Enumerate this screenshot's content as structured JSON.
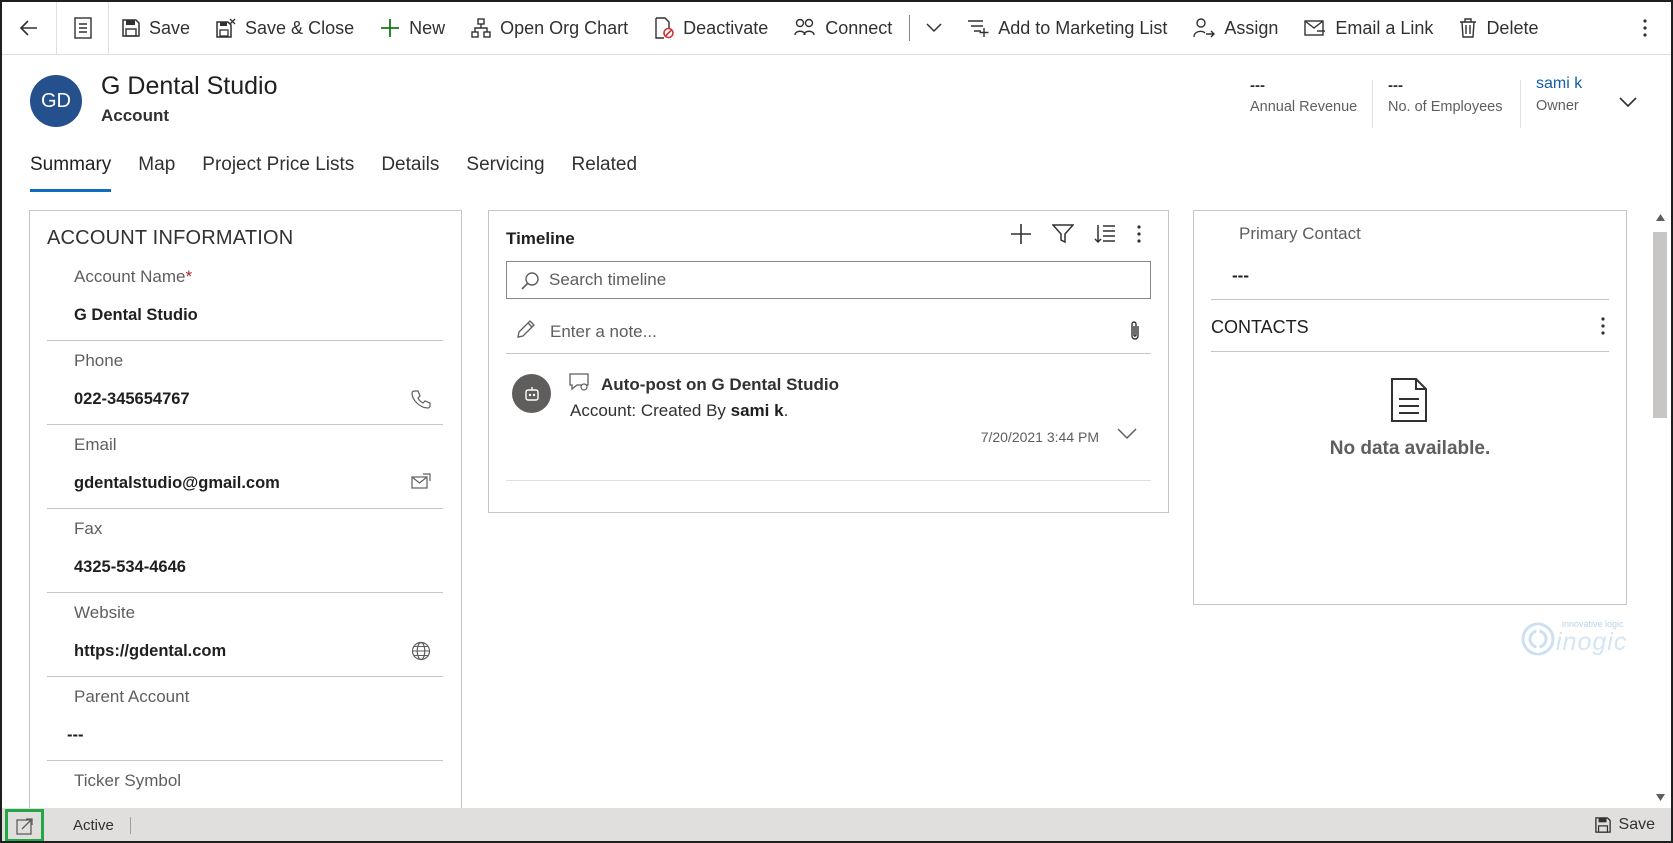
{
  "toolbar": {
    "save": "Save",
    "save_close": "Save & Close",
    "new": "New",
    "org_chart": "Open Org Chart",
    "deactivate": "Deactivate",
    "connect": "Connect",
    "marketing": "Add to Marketing List",
    "assign": "Assign",
    "email_link": "Email a Link",
    "delete": "Delete"
  },
  "header": {
    "initials": "GD",
    "title": "G Dental Studio",
    "entity": "Account",
    "fields": [
      {
        "label": "Annual Revenue",
        "value": "---"
      },
      {
        "label": "No. of Employees",
        "value": "---"
      },
      {
        "label": "Owner",
        "value": "sami k"
      }
    ]
  },
  "tabs": [
    "Summary",
    "Map",
    "Project Price Lists",
    "Details",
    "Servicing",
    "Related"
  ],
  "account_info": {
    "title": "ACCOUNT INFORMATION",
    "required_mark": "*",
    "fields": [
      {
        "label": "Account Name",
        "value": "G Dental Studio"
      },
      {
        "label": "Phone",
        "value": "022-345654767",
        "icon": "phone-icon"
      },
      {
        "label": "Email",
        "value": "gdentalstudio@gmail.com",
        "icon": "email-icon"
      },
      {
        "label": "Fax",
        "value": "4325-534-4646"
      },
      {
        "label": "Website",
        "value": "https://gdental.com",
        "icon": "globe-icon"
      },
      {
        "label": "Parent Account",
        "value": "---"
      },
      {
        "label": "Ticker Symbol",
        "value": ""
      }
    ]
  },
  "timeline": {
    "title": "Timeline",
    "search_placeholder": "Search timeline",
    "note_placeholder": "Enter a note...",
    "item": {
      "title": "Auto-post on G Dental Studio",
      "body_prefix": "Account: Created By ",
      "author": "sami k",
      "body_suffix": ".",
      "date": "7/20/2021 3:44 PM"
    }
  },
  "right_panel": {
    "primary_contact_label": "Primary Contact",
    "primary_contact_value": "---",
    "contacts_title": "CONTACTS",
    "empty_text": "No data available."
  },
  "watermark": {
    "tagline": "innovative logic",
    "brand": "inogic"
  },
  "footer": {
    "status": "Active",
    "save": "Save"
  },
  "colors": {
    "avatar": "#24518d",
    "tab_underline": "#0f6cbd",
    "owner_link": "#115ea3",
    "highlight": "#22a842"
  }
}
